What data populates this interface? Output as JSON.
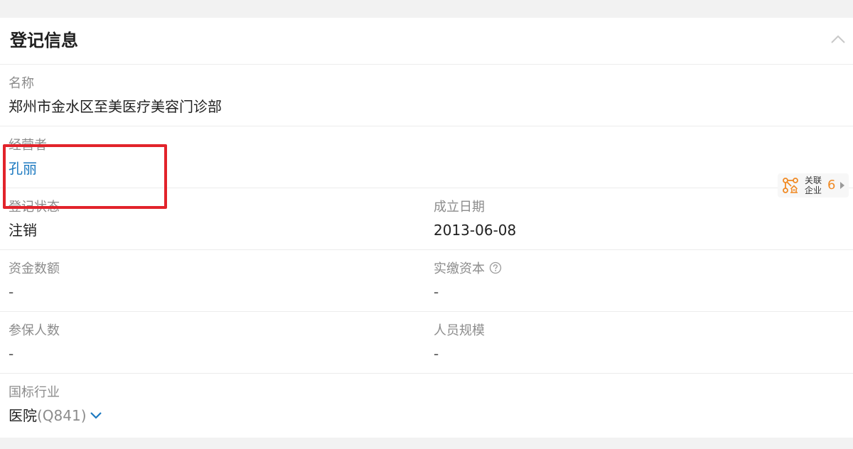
{
  "section": {
    "title": "登记信息"
  },
  "fields": {
    "name": {
      "label": "名称",
      "value": "郑州市金水区至美医疗美容门诊部"
    },
    "operator": {
      "label": "经营者",
      "value": "孔丽"
    },
    "related": {
      "line1": "关联",
      "line2": "企业",
      "count": "6"
    },
    "status": {
      "label": "登记状态",
      "value": "注销"
    },
    "established": {
      "label": "成立日期",
      "value": "2013-06-08"
    },
    "capital": {
      "label": "资金数额",
      "value": "-"
    },
    "paid_capital": {
      "label": "实缴资本",
      "value": "-"
    },
    "insured": {
      "label": "参保人数",
      "value": "-"
    },
    "staff_size": {
      "label": "人员规模",
      "value": "-"
    },
    "industry": {
      "label": "国标行业",
      "value": "医院",
      "code": "(Q841)"
    }
  },
  "icons": {
    "collapse": "chevron-up-icon",
    "help": "question-circle-icon",
    "related": "relation-graph-icon",
    "expand": "chevron-down-icon"
  },
  "colors": {
    "link": "#1c79c0",
    "highlight": "#e2232b",
    "badge_count": "#f08a24"
  }
}
